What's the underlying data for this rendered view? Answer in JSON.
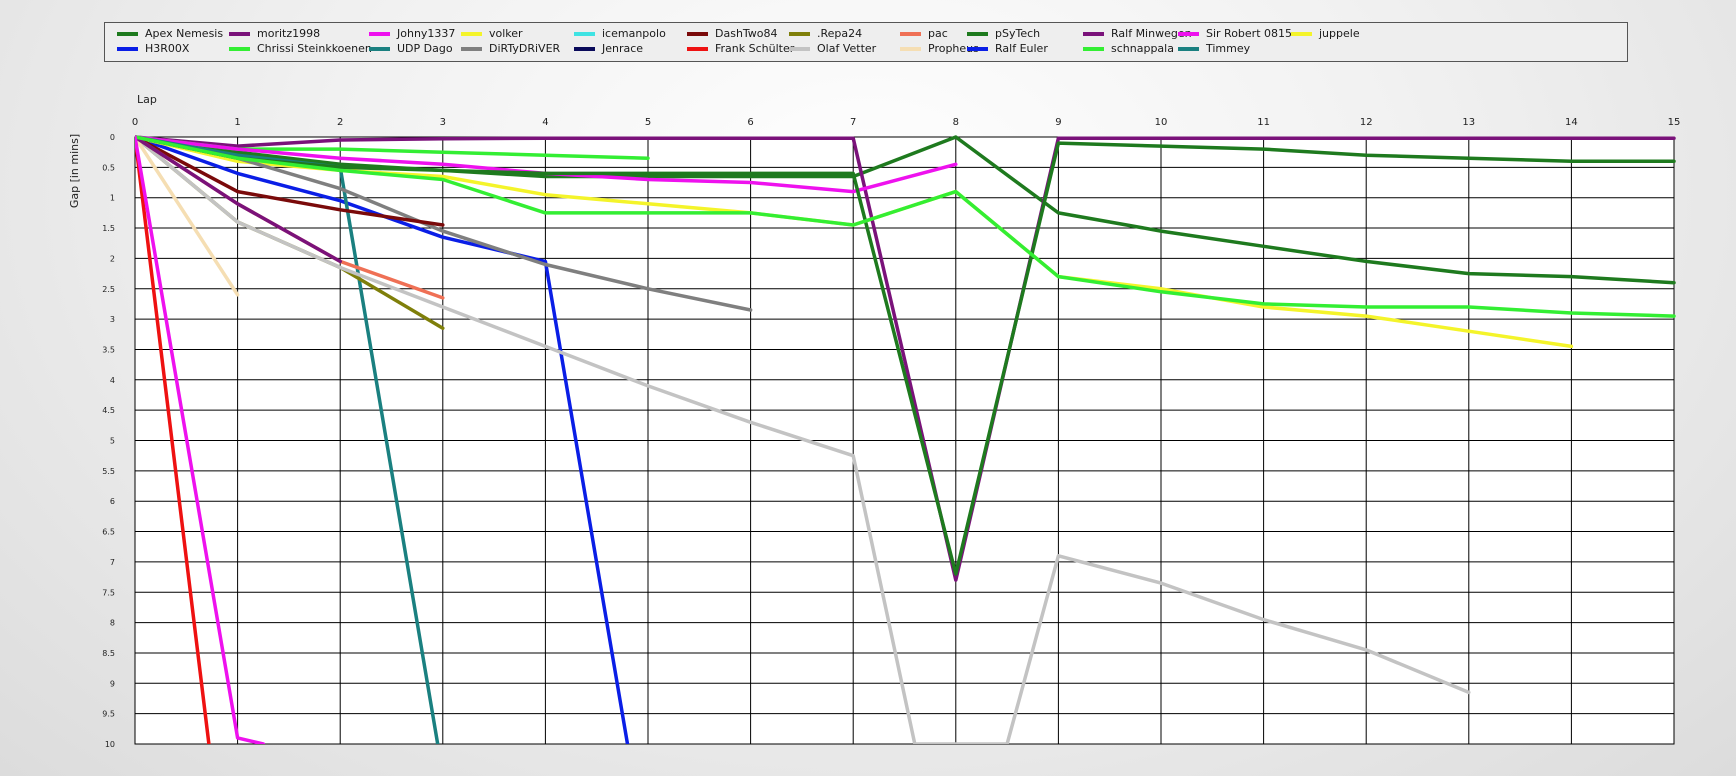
{
  "chart_data": {
    "type": "line",
    "title": "",
    "xlabel": "Lap",
    "ylabel": "Gap [in mins]",
    "xlim": [
      0,
      15
    ],
    "ylim": [
      0,
      10
    ],
    "y_inverted": true,
    "grid": true,
    "legend_position": "top",
    "x_ticks": [
      "0",
      "1",
      "2",
      "3",
      "4",
      "5",
      "6",
      "7",
      "8",
      "9",
      "10",
      "11",
      "12",
      "13",
      "14",
      "15"
    ],
    "y_ticks": [
      "0",
      "0.5",
      "1",
      "1.5",
      "2",
      "2.5",
      "3",
      "3.5",
      "4",
      "4.5",
      "5",
      "5.5",
      "6",
      "6.5",
      "7",
      "7.5",
      "8",
      "8.5",
      "9",
      "9.5",
      "10"
    ],
    "series": [
      {
        "name": "Apex Nemesis",
        "color": "#1e7a1e",
        "points": [
          [
            0,
            0
          ],
          [
            1,
            0.25
          ],
          [
            2,
            0.45
          ],
          [
            3,
            0.55
          ],
          [
            4,
            0.65
          ],
          [
            5,
            0.65
          ],
          [
            6,
            0.65
          ],
          [
            7,
            0.65
          ],
          [
            8,
            0
          ],
          [
            9,
            1.25
          ],
          [
            10,
            1.55
          ],
          [
            11,
            1.8
          ],
          [
            12,
            2.05
          ],
          [
            13,
            2.25
          ],
          [
            14,
            2.3
          ],
          [
            15,
            2.4
          ]
        ]
      },
      {
        "name": "H3R00X",
        "color": "#0a1ee6",
        "points": [
          [
            0,
            0
          ],
          [
            1,
            0.6
          ],
          [
            2,
            1.05
          ],
          [
            3,
            1.65
          ],
          [
            4,
            2.05
          ],
          [
            4.8,
            10
          ]
        ]
      },
      {
        "name": "moritz1998",
        "color": "#7a127a",
        "points": [
          [
            0,
            0
          ],
          [
            1,
            0.15
          ],
          [
            2,
            0.05
          ],
          [
            3,
            0.03
          ],
          [
            4,
            0.02
          ],
          [
            5,
            0.02
          ],
          [
            6,
            0.02
          ],
          [
            7,
            0.02
          ],
          [
            8,
            7.3
          ],
          [
            9,
            0.02
          ],
          [
            10,
            0.02
          ],
          [
            11,
            0.02
          ],
          [
            12,
            0.02
          ],
          [
            13,
            0.02
          ],
          [
            14,
            0.02
          ],
          [
            15,
            0.02
          ]
        ]
      },
      {
        "name": "Chrissi Steinkkoenen",
        "color": "#33ee33",
        "points": [
          [
            0,
            0
          ],
          [
            1,
            0.2
          ],
          [
            2,
            0.2
          ],
          [
            3,
            0.25
          ],
          [
            4,
            0.3
          ],
          [
            5,
            0.35
          ]
        ]
      },
      {
        "name": "Johny1337",
        "color": "#ee11ee",
        "points": [
          [
            0,
            0
          ],
          [
            1,
            0.2
          ],
          [
            2,
            0.35
          ],
          [
            3,
            0.45
          ],
          [
            4,
            0.6
          ],
          [
            5,
            0.7
          ],
          [
            6,
            0.75
          ],
          [
            7,
            0.9
          ],
          [
            8,
            0.45
          ]
        ]
      },
      {
        "name": "UDP Dago",
        "color": "#1a8080",
        "points": [
          [
            0,
            0
          ],
          [
            1,
            0.3
          ],
          [
            2,
            0.5
          ],
          [
            2.95,
            10
          ]
        ]
      },
      {
        "name": "volker",
        "color": "#f4f42a",
        "points": [
          [
            0,
            0
          ],
          [
            1,
            0.4
          ],
          [
            2,
            0.55
          ],
          [
            3,
            0.65
          ],
          [
            4,
            0.95
          ],
          [
            5,
            1.1
          ],
          [
            6,
            1.25
          ],
          [
            7,
            1.45
          ],
          [
            8,
            0.9
          ],
          [
            9,
            2.3
          ],
          [
            10,
            2.5
          ],
          [
            11,
            2.8
          ],
          [
            12,
            2.95
          ],
          [
            13,
            3.2
          ],
          [
            14,
            3.45
          ]
        ]
      },
      {
        "name": "DiRTyDRiVER",
        "color": "#7f7f7f",
        "points": [
          [
            0,
            0
          ],
          [
            1,
            0.35
          ],
          [
            2,
            0.85
          ],
          [
            3,
            1.55
          ],
          [
            4,
            2.1
          ],
          [
            5,
            2.5
          ],
          [
            6,
            2.85
          ]
        ]
      },
      {
        "name": "icemanpolo",
        "color": "#3fe3e3",
        "points": []
      },
      {
        "name": "Jenrace",
        "color": "#0a0a5a",
        "points": []
      },
      {
        "name": "DashTwo84",
        "color": "#7a0a0a",
        "points": [
          [
            0,
            0
          ],
          [
            1,
            0.9
          ],
          [
            2,
            1.2
          ],
          [
            3,
            1.45
          ]
        ]
      },
      {
        "name": "Frank Schülter",
        "color": "#ee1111",
        "points": [
          [
            0,
            0
          ],
          [
            0.72,
            10
          ]
        ]
      },
      {
        "name": ".Repa24",
        "color": "#7f7f0a",
        "points": [
          [
            0,
            0
          ],
          [
            1,
            1.4
          ],
          [
            2,
            2.15
          ],
          [
            3,
            3.15
          ]
        ]
      },
      {
        "name": "Olaf Vetter",
        "color": "#c3c3c3",
        "points": [
          [
            0,
            0
          ],
          [
            1,
            1.4
          ],
          [
            2,
            2.15
          ],
          [
            3,
            2.8
          ],
          [
            4,
            3.45
          ],
          [
            5,
            4.1
          ],
          [
            6,
            4.7
          ],
          [
            7,
            5.25
          ],
          [
            7.6,
            10
          ],
          [
            8.5,
            10
          ],
          [
            9,
            6.9
          ],
          [
            10,
            7.35
          ],
          [
            11,
            7.95
          ],
          [
            12,
            8.45
          ],
          [
            13,
            9.15
          ]
        ]
      },
      {
        "name": "pac",
        "color": "#ef7055",
        "points": [
          [
            0,
            0
          ],
          [
            1,
            1.1
          ],
          [
            2,
            2.05
          ],
          [
            3,
            2.65
          ]
        ]
      },
      {
        "name": "Propheus",
        "color": "#f5deb3",
        "points": [
          [
            0,
            0
          ],
          [
            1,
            2.6
          ]
        ]
      },
      {
        "name": "pSyTech",
        "color": "#1e7a1e",
        "points": [
          [
            0,
            0
          ],
          [
            1,
            0.35
          ],
          [
            2,
            0.5
          ],
          [
            3,
            0.55
          ],
          [
            4,
            0.6
          ],
          [
            5,
            0.6
          ],
          [
            6,
            0.6
          ],
          [
            7,
            0.6
          ],
          [
            8,
            7.2
          ],
          [
            9,
            0.1
          ],
          [
            10,
            0.15
          ],
          [
            11,
            0.2
          ],
          [
            12,
            0.3
          ],
          [
            13,
            0.35
          ],
          [
            14,
            0.4
          ],
          [
            15,
            0.4
          ]
        ]
      },
      {
        "name": "Ralf Euler",
        "color": "#0a1ee6",
        "points": []
      },
      {
        "name": "Ralf Minwegen",
        "color": "#7a127a",
        "points": [
          [
            0,
            0
          ],
          [
            1,
            1.1
          ],
          [
            2,
            2.05
          ]
        ]
      },
      {
        "name": "schnappala",
        "color": "#33ee33",
        "points": [
          [
            0,
            0
          ],
          [
            1,
            0.35
          ],
          [
            2,
            0.55
          ],
          [
            3,
            0.7
          ],
          [
            4,
            1.25
          ],
          [
            5,
            1.25
          ],
          [
            6,
            1.25
          ],
          [
            7,
            1.45
          ],
          [
            8,
            0.9
          ],
          [
            9,
            2.3
          ],
          [
            10,
            2.55
          ],
          [
            11,
            2.75
          ],
          [
            12,
            2.8
          ],
          [
            13,
            2.8
          ],
          [
            14,
            2.9
          ],
          [
            15,
            2.95
          ]
        ]
      },
      {
        "name": "Sir Robert 0815",
        "color": "#ee11ee",
        "points": [
          [
            0,
            0
          ],
          [
            1,
            9.9
          ],
          [
            1.25,
            10
          ]
        ]
      },
      {
        "name": "Timmey",
        "color": "#1a8080",
        "points": []
      },
      {
        "name": "juppele",
        "color": "#f4f42a",
        "points": []
      }
    ]
  }
}
